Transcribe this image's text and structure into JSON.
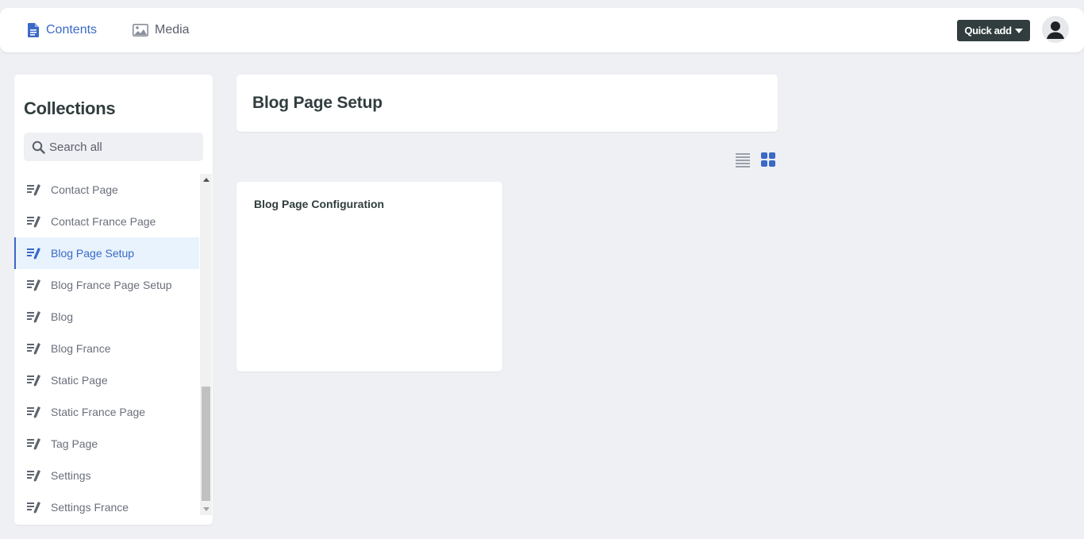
{
  "topbar": {
    "contents_label": "Contents",
    "media_label": "Media",
    "quick_add_label": "Quick add",
    "accent_color": "#3a69c7"
  },
  "sidebar": {
    "title": "Collections",
    "search_placeholder": "Search all",
    "items": [
      {
        "label": "Contact Page",
        "icon": "write-icon",
        "active": false
      },
      {
        "label": "Contact France Page",
        "icon": "write-icon",
        "active": false
      },
      {
        "label": "Blog Page Setup",
        "icon": "write-icon",
        "active": true
      },
      {
        "label": "Blog France Page Setup",
        "icon": "write-icon",
        "active": false
      },
      {
        "label": "Blog",
        "icon": "write-icon",
        "active": false
      },
      {
        "label": "Blog France",
        "icon": "write-icon",
        "active": false
      },
      {
        "label": "Static Page",
        "icon": "write-icon",
        "active": false
      },
      {
        "label": "Static France Page",
        "icon": "write-icon",
        "active": false
      },
      {
        "label": "Tag Page",
        "icon": "write-icon",
        "active": false
      },
      {
        "label": "Settings",
        "icon": "write-icon",
        "active": false
      },
      {
        "label": "Settings France",
        "icon": "write-icon",
        "active": false
      }
    ]
  },
  "main": {
    "title": "Blog Page Setup",
    "view_mode": "grid",
    "entries": [
      {
        "title": "Blog Page Configuration"
      }
    ]
  }
}
